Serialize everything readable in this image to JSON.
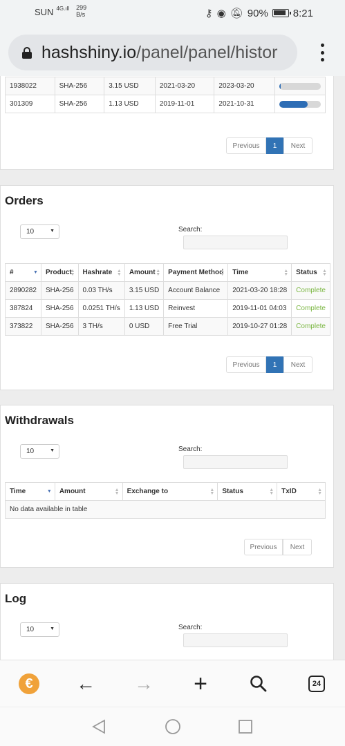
{
  "status_bar": {
    "carrier": "SUN",
    "network": "4G",
    "speed_value": "299",
    "speed_unit": "B/s",
    "battery": "90%",
    "time": "8:21"
  },
  "browser": {
    "url_domain": "hashshiny.io",
    "url_path": "/panel/panel/histor",
    "tabs_count": "24"
  },
  "contracts": {
    "rows": [
      {
        "id": "1938022",
        "product": "SHA-256",
        "price": "3.15 USD",
        "start": "2021-03-20",
        "end": "2023-03-20",
        "progress": 0.02
      },
      {
        "id": "301309",
        "product": "SHA-256",
        "price": "1.13 USD",
        "start": "2019-11-01",
        "end": "2021-10-31",
        "progress": 0.68
      }
    ],
    "pager": {
      "prev": "Previous",
      "page": "1",
      "next": "Next"
    }
  },
  "orders": {
    "title": "Orders",
    "length": "10",
    "search_label": "Search:",
    "columns": [
      "#",
      "Product",
      "Hashrate",
      "Amount",
      "Payment Method",
      "Time",
      "Status"
    ],
    "rows": [
      [
        "2890282",
        "SHA-256",
        "0.03 TH/s",
        "3.15 USD",
        "Account Balance",
        "2021-03-20 18:28",
        "Complete"
      ],
      [
        "387824",
        "SHA-256",
        "0.0251 TH/s",
        "1.13 USD",
        "Reinvest",
        "2019-11-01 04:03",
        "Complete"
      ],
      [
        "373822",
        "SHA-256",
        "3 TH/s",
        "0 USD",
        "Free Trial",
        "2019-10-27 01:28",
        "Complete"
      ]
    ],
    "pager": {
      "prev": "Previous",
      "page": "1",
      "next": "Next"
    }
  },
  "withdrawals": {
    "title": "Withdrawals",
    "length": "10",
    "search_label": "Search:",
    "columns": [
      "Time",
      "Amount",
      "Exchange to",
      "Status",
      "TxID"
    ],
    "empty": "No data available in table",
    "pager": {
      "prev": "Previous",
      "next": "Next"
    }
  },
  "log": {
    "title": "Log",
    "length": "10",
    "search_label": "Search:"
  },
  "colors": {
    "accent": "#3173b5",
    "complete": "#7ab641",
    "coin": "#f0a23a"
  }
}
